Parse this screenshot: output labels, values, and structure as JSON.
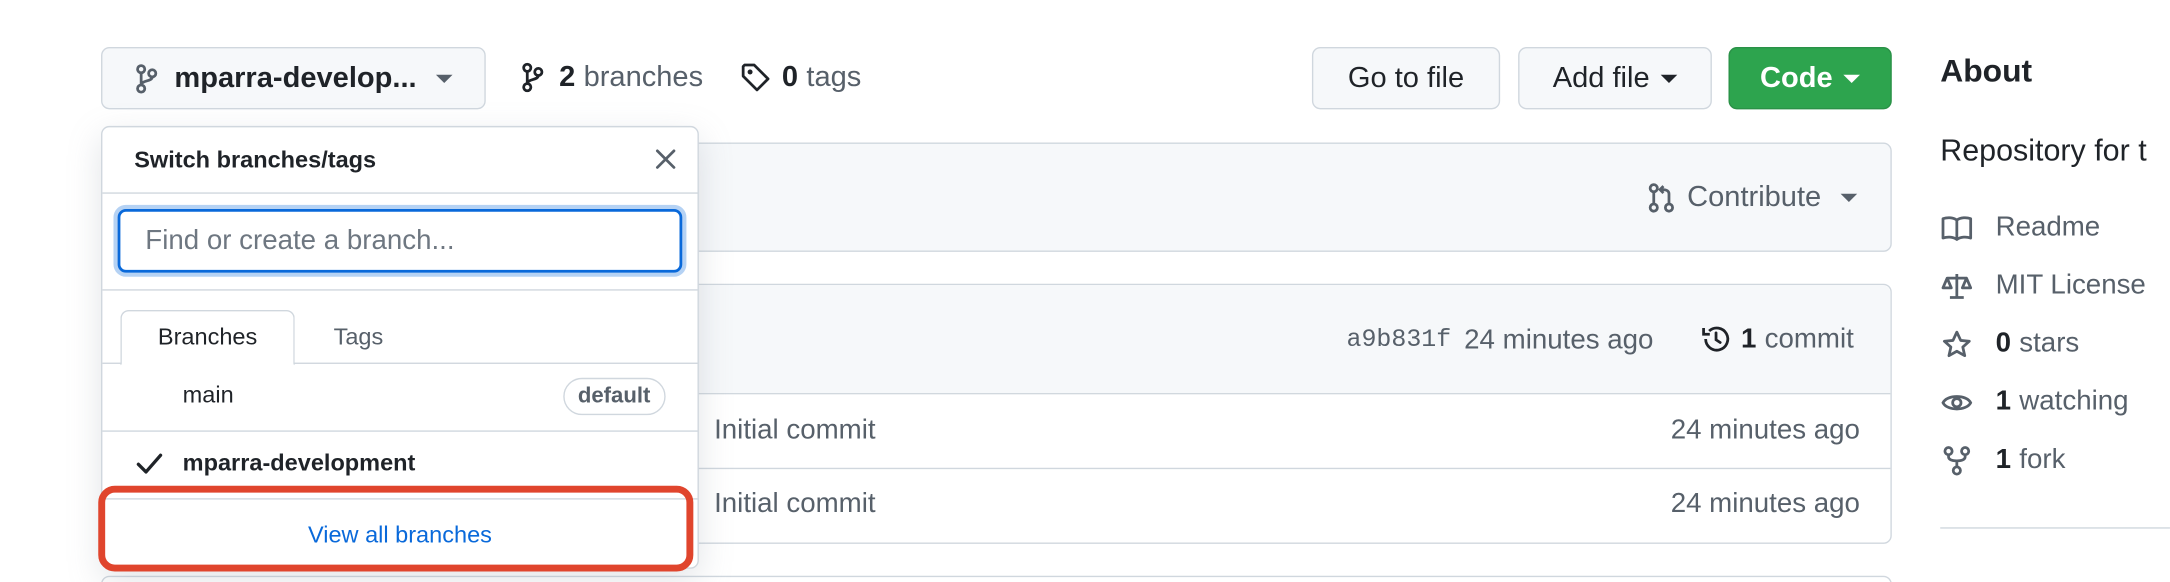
{
  "toolbar": {
    "branch_button_label": "mparra-develop...",
    "branches_count": "2",
    "branches_label": "branches",
    "tags_count": "0",
    "tags_label": "tags",
    "goto_file_label": "Go to file",
    "add_file_label": "Add file",
    "code_label": "Code"
  },
  "contribute": {
    "label": "Contribute"
  },
  "latest_commit": {
    "hash": "a9b831f",
    "time": "24 minutes ago",
    "count": "1",
    "count_label": "commit"
  },
  "files": [
    {
      "message": "Initial commit",
      "age": "24 minutes ago"
    },
    {
      "message": "Initial commit",
      "age": "24 minutes ago"
    }
  ],
  "dropdown": {
    "title": "Switch branches/tags",
    "placeholder": "Find or create a branch...",
    "tabs": [
      "Branches",
      "Tags"
    ],
    "branches": [
      {
        "name": "main",
        "badge": "default",
        "selected": false
      },
      {
        "name": "mparra-development",
        "selected": true
      }
    ],
    "view_all": "View all branches"
  },
  "about": {
    "title": "About",
    "description": "Repository for t",
    "readme": "Readme",
    "license": "MIT License",
    "stars_count": "0",
    "stars_label": "stars",
    "watching_count": "1",
    "watching_label": "watching",
    "forks_count": "1",
    "forks_label": "fork"
  },
  "colors": {
    "accent_link": "#0969da",
    "code_button": "#2da44e",
    "highlight": "#e0452d"
  }
}
